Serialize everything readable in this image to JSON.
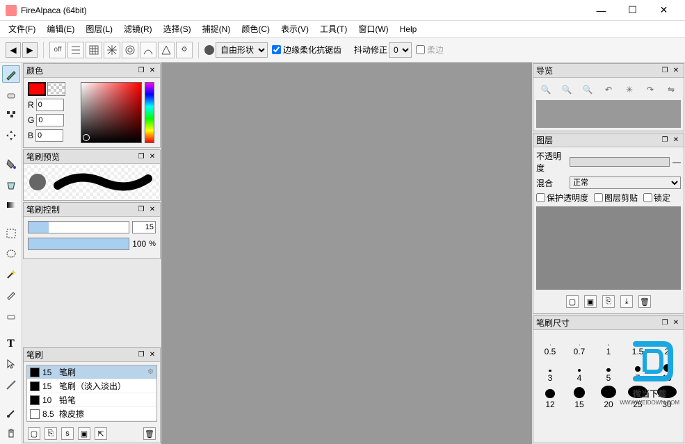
{
  "title": "FireAlpaca (64bit)",
  "menus": [
    "文件(F)",
    "编辑(E)",
    "图层(L)",
    "滤镜(R)",
    "选择(S)",
    "捕捉(N)",
    "颜色(C)",
    "表示(V)",
    "工具(T)",
    "窗口(W)",
    "Help"
  ],
  "toolbar": {
    "off_label": "off",
    "shape_select": "自由形状",
    "antialias_label": "边缘柔化抗锯齿",
    "jitter_label": "抖动修正",
    "jitter_value": "0",
    "soft_label": "柔边"
  },
  "panels": {
    "color": {
      "title": "颜色",
      "r_label": "R",
      "g_label": "G",
      "b_label": "B",
      "r": "0",
      "g": "0",
      "b": "0"
    },
    "brush_preview": {
      "title": "笔刷预览"
    },
    "brush_control": {
      "title": "笔刷控制",
      "size_value": "15",
      "opacity_value": "100",
      "pct": "%"
    },
    "brush": {
      "title": "笔刷",
      "items": [
        {
          "size": "15",
          "name": "笔刷",
          "sw": "#000",
          "sel": true
        },
        {
          "size": "15",
          "name": "笔刷（淡入淡出）",
          "sw": "#000"
        },
        {
          "size": "10",
          "name": "铅笔",
          "sw": "#000"
        },
        {
          "size": "8.5",
          "name": "橡皮擦",
          "sw": "#fff"
        }
      ]
    },
    "navigator": {
      "title": "导览"
    },
    "layers": {
      "title": "图层",
      "opacity_label": "不透明度",
      "blend_label": "混合",
      "blend_value": "正常",
      "check1": "保护透明度",
      "check2": "图层剪贴",
      "check3": "锁定"
    },
    "brush_size": {
      "title": "笔刷尺寸",
      "sizes": [
        "0.5",
        "0.7",
        "1",
        "1.5",
        "2",
        "3",
        "4",
        "5",
        "7",
        "10",
        "12",
        "15",
        "20",
        "25",
        "30"
      ]
    }
  },
  "watermark": {
    "line1": "微当下载",
    "line2": "WWW.WEIDOWN.COM"
  }
}
